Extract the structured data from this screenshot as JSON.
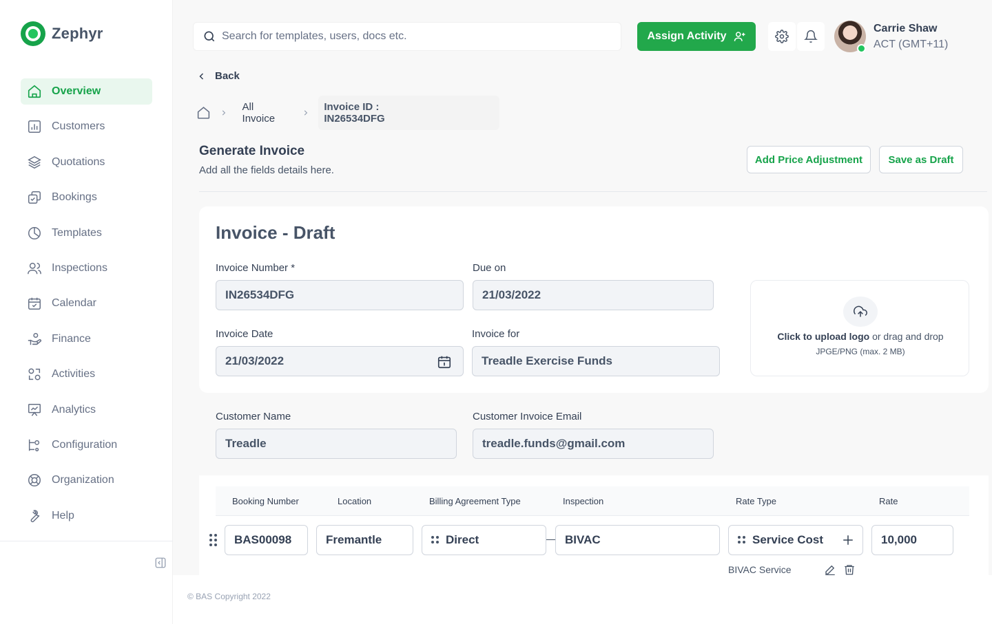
{
  "app": {
    "name": "Zephyr"
  },
  "sidebar": {
    "items": [
      {
        "label": "Overview",
        "icon": "home-icon",
        "active": true
      },
      {
        "label": "Customers",
        "icon": "chart-bar-icon"
      },
      {
        "label": "Quotations",
        "icon": "layers-icon"
      },
      {
        "label": "Bookings",
        "icon": "booking-icon"
      },
      {
        "label": "Templates",
        "icon": "pie-chart-icon"
      },
      {
        "label": "Inspections",
        "icon": "users-icon"
      },
      {
        "label": "Calendar",
        "icon": "calendar-icon"
      },
      {
        "label": "Finance",
        "icon": "finance-icon"
      },
      {
        "label": "Activities",
        "icon": "activities-icon"
      },
      {
        "label": "Analytics",
        "icon": "presentation-icon"
      },
      {
        "label": "Configuration",
        "icon": "configuration-icon"
      },
      {
        "label": "Organization",
        "icon": "lifebuoy-icon"
      },
      {
        "label": "Help",
        "icon": "wrench-icon"
      }
    ]
  },
  "header": {
    "search_placeholder": "Search for templates, users, docs etc.",
    "assign_button": "Assign Activity",
    "user": {
      "name": "Carrie Shaw",
      "timezone": "ACT (GMT+11)"
    }
  },
  "nav": {
    "back_label": "Back",
    "breadcrumb": {
      "all_invoice": "All Invoice",
      "current": "Invoice ID : IN26534DFG"
    }
  },
  "page": {
    "title": "Generate Invoice",
    "subtitle": "Add all the fields details here.",
    "add_price_adjustment": "Add Price Adjustment",
    "save_as_draft": "Save as Draft"
  },
  "invoice": {
    "title": "Invoice - Draft",
    "invoice_number_label": "Invoice Number *",
    "invoice_number": "IN26534DFG",
    "due_on_label": "Due on",
    "due_on": "21/03/2022",
    "invoice_date_label": "Invoice Date",
    "invoice_date": "21/03/2022",
    "invoice_for_label": "Invoice for",
    "invoice_for": "Treadle Exercise Funds",
    "customer_name_label": "Customer Name",
    "customer_name": "Treadle",
    "customer_email_label": "Customer Invoice Email",
    "customer_email": "treadle.funds@gmail.com",
    "upload": {
      "action": "Click to upload logo",
      "rest": " or drag and drop",
      "hint": "JPGE/PNG (max. 2 MB)"
    }
  },
  "table": {
    "headers": {
      "booking_number": "Booking Number",
      "location": "Location",
      "billing_agreement_type": "Billing Agreement Type",
      "inspection": "Inspection",
      "rate_type": "Rate Type",
      "rate": "Rate"
    },
    "row": {
      "booking_number": "BAS00098",
      "location": "Fremantle",
      "billing_agreement_type": "Direct",
      "inspection": "BIVAC",
      "rate_type": "Service Cost",
      "rate": "10,000",
      "service_label": "BIVAC Service"
    }
  },
  "footer": {
    "copyright": "© BAS Copyright 2022"
  },
  "colors": {
    "brand": "#22a84b",
    "active_bg": "#e9f7ee"
  }
}
